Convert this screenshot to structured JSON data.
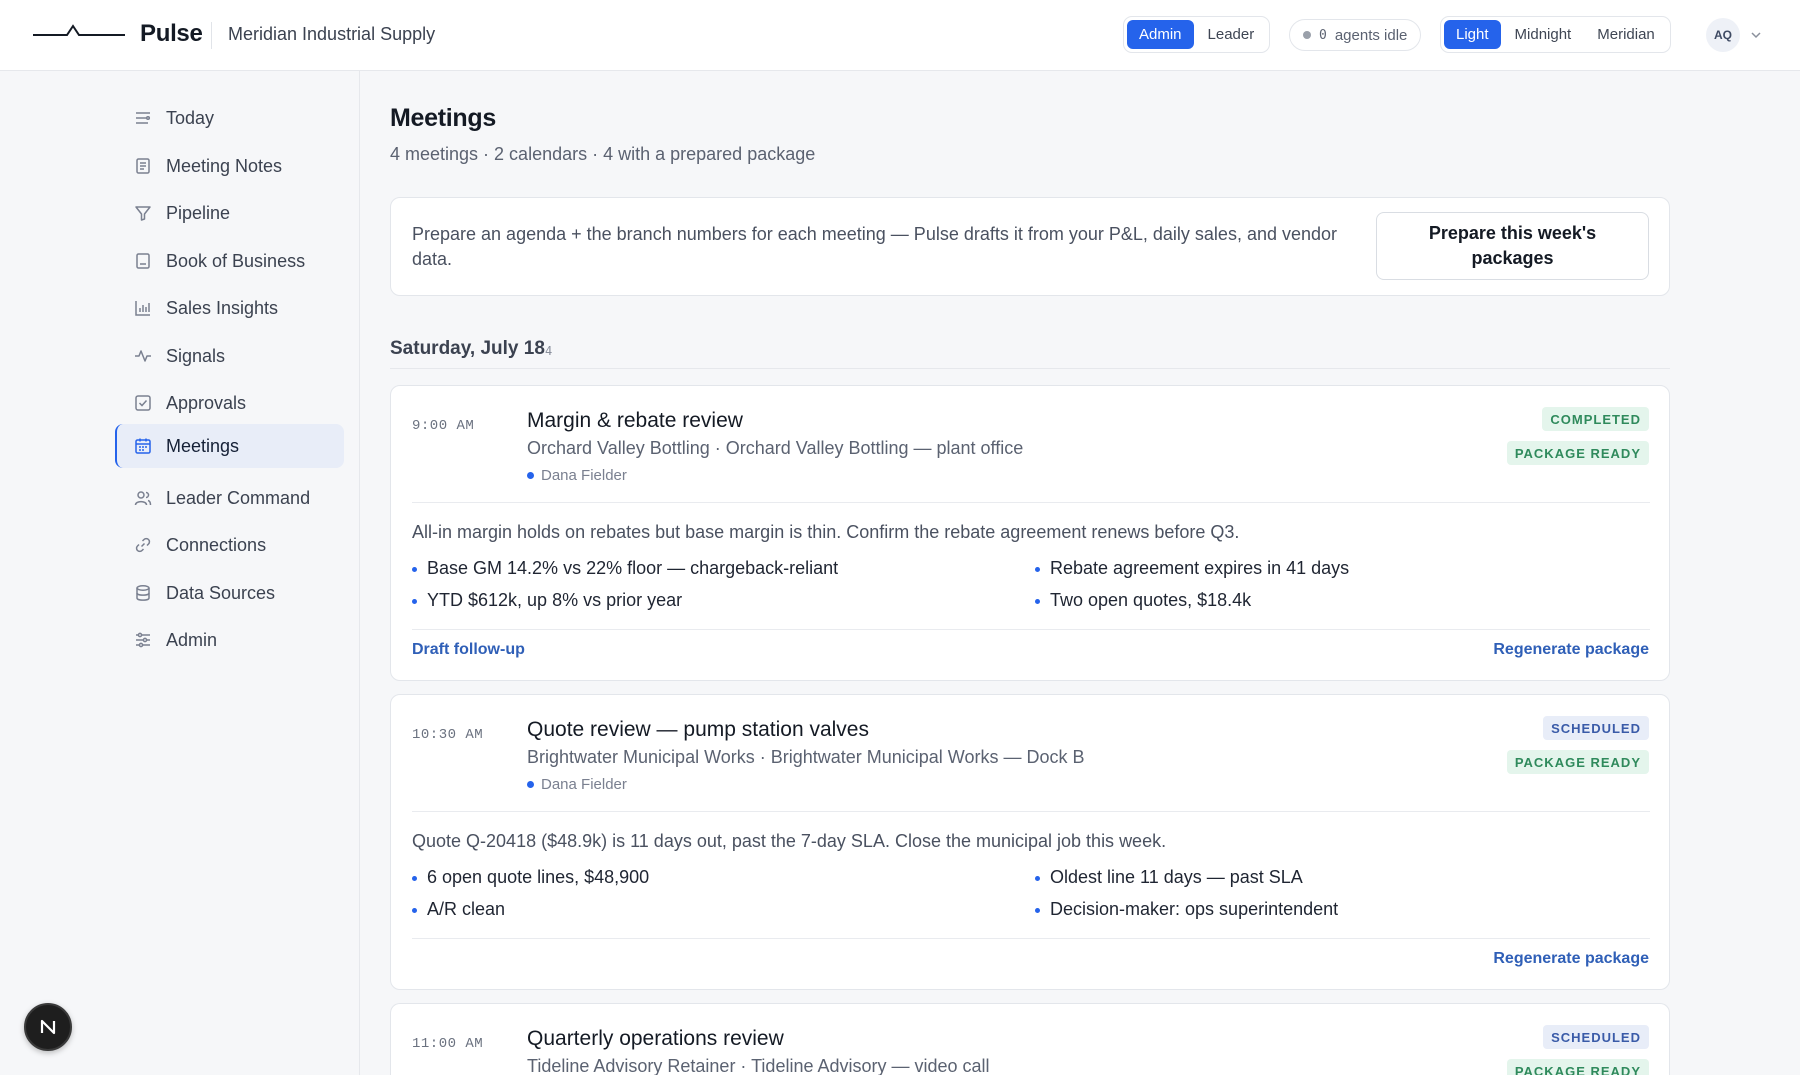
{
  "header": {
    "app_name": "Pulse",
    "org_name": "Meridian Industrial Supply",
    "role_options": [
      "Admin",
      "Leader"
    ],
    "role_selected": "Admin",
    "agents_count": "0",
    "agents_label": "agents idle",
    "theme_options": [
      "Light",
      "Midnight",
      "Meridian"
    ],
    "theme_selected": "Light",
    "avatar_initials": "AQ"
  },
  "sidebar": {
    "items": [
      {
        "label": "Today",
        "icon": "today-icon"
      },
      {
        "label": "Meeting Notes",
        "icon": "notes-icon"
      },
      {
        "label": "Pipeline",
        "icon": "filter-icon"
      },
      {
        "label": "Book of Business",
        "icon": "book-icon"
      },
      {
        "label": "Sales Insights",
        "icon": "bar-chart-icon"
      },
      {
        "label": "Signals",
        "icon": "pulse-icon"
      },
      {
        "label": "Approvals",
        "icon": "check-square-icon"
      },
      {
        "label": "Meetings",
        "icon": "calendar-icon"
      },
      {
        "label": "Leader Command",
        "icon": "users-icon"
      },
      {
        "label": "Connections",
        "icon": "link-icon"
      },
      {
        "label": "Data Sources",
        "icon": "database-icon"
      },
      {
        "label": "Admin",
        "icon": "sliders-icon"
      }
    ],
    "active": "Meetings"
  },
  "main": {
    "title": "Meetings",
    "subtitle": "4 meetings · 2 calendars · 4 with a prepared package",
    "banner_text": "Prepare an agenda + the branch numbers for each meeting — Pulse drafts it from your P&L, daily sales, and vendor data.",
    "banner_button": "Prepare this week's packages",
    "day_heading": "Saturday, July 18",
    "day_count": "4",
    "meetings": [
      {
        "time": "9:00 AM",
        "title": "Margin & rebate review",
        "subtitle": "Orchard Valley Bottling · Orchard Valley Bottling — plant office",
        "owner": "Dana Fielder",
        "status": "COMPLETED",
        "package": "PACKAGE READY",
        "summary": "All-in margin holds on rebates but base margin is thin. Confirm the rebate agreement renews before Q3.",
        "bullets_left": [
          "Base GM 14.2% vs 22% floor — chargeback-reliant",
          "YTD $612k, up 8% vs prior year"
        ],
        "bullets_right": [
          "Rebate agreement expires in 41 days",
          "Two open quotes, $18.4k"
        ],
        "left_action": "Draft follow-up",
        "right_action": "Regenerate package"
      },
      {
        "time": "10:30 AM",
        "title": "Quote review — pump station valves",
        "subtitle": "Brightwater Municipal Works · Brightwater Municipal Works — Dock B",
        "owner": "Dana Fielder",
        "status": "SCHEDULED",
        "package": "PACKAGE READY",
        "summary": "Quote Q-20418 ($48.9k) is 11 days out, past the 7-day SLA. Close the municipal job this week.",
        "bullets_left": [
          "6 open quote lines, $48,900",
          "A/R clean"
        ],
        "bullets_right": [
          "Oldest line 11 days — past SLA",
          "Decision-maker: ops superintendent"
        ],
        "right_action": "Regenerate package"
      },
      {
        "time": "11:00 AM",
        "title": "Quarterly operations review",
        "subtitle": "Tideline Advisory Retainer · Tideline Advisory — video call",
        "status": "SCHEDULED",
        "package": "PACKAGE READY"
      }
    ]
  },
  "fab": {
    "letter": "N"
  }
}
